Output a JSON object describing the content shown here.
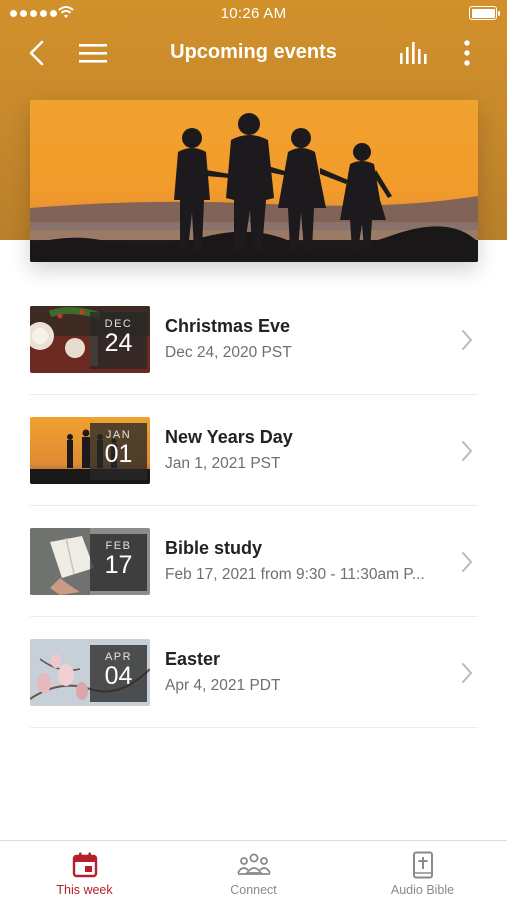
{
  "status_bar": {
    "time": "10:26 AM"
  },
  "nav": {
    "title": "Upcoming events",
    "back_icon": "chevron-left-icon",
    "menu_icon": "hamburger-menu-icon",
    "chart_icon": "bar-chart-icon",
    "more_icon": "more-vertical-icon"
  },
  "hero": {
    "image": "family-sunset-silhouette"
  },
  "events": [
    {
      "title": "Christmas Eve",
      "subtitle": "Dec 24, 2020 PST",
      "month": "DEC",
      "day": "24",
      "image": "christmas-dinner-table"
    },
    {
      "title": "New Years Day",
      "subtitle": "Jan 1, 2021 PST",
      "month": "JAN",
      "day": "01",
      "image": "family-sunset"
    },
    {
      "title": "Bible study",
      "subtitle": "Feb 17, 2021 from 9:30 - 11:30am P...",
      "month": "FEB",
      "day": "17",
      "image": "open-bible"
    },
    {
      "title": "Easter",
      "subtitle": "Apr 4, 2021 PDT",
      "month": "APR",
      "day": "04",
      "image": "magnolia-flowers"
    }
  ],
  "tabs": [
    {
      "label": "This week",
      "icon": "calendar-icon",
      "active": true
    },
    {
      "label": "Connect",
      "icon": "people-group-icon",
      "active": false
    },
    {
      "label": "Audio Bible",
      "icon": "bible-book-icon",
      "active": false
    }
  ],
  "colors": {
    "header": "#c98a2c",
    "accent": "#b61f2c",
    "muted": "#8a8a8a"
  }
}
